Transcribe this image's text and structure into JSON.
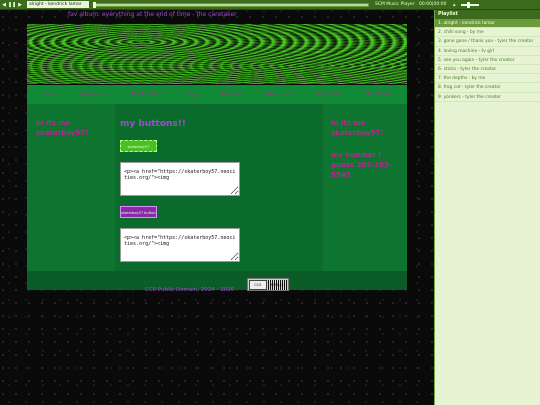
{
  "player": {
    "prev_icon": "prev-icon",
    "play_icon": "play-icon",
    "pause_icon": "pause-icon",
    "next_icon": "next-icon",
    "now_playing": "alright - kendrick lamar",
    "name": "SCM Music Player",
    "time": "00:00|00:00",
    "volume_icon": "volume-icon",
    "volume": 0.4,
    "progress": 0
  },
  "playlist": {
    "title": "Playlist",
    "items": [
      "1. alright - kendrick lamar",
      "2. chilli song - by me",
      "3. gone gone / thank you - tyler the creator",
      "4. loving machine - tv girl",
      "5. see you again - tyler the creator",
      "6. sticks - tyler the creator",
      "7. the depths - by me",
      "8. frog cat - tyler the creator",
      "9. yonkers - tyler the creator"
    ],
    "active_index": 0
  },
  "page": {
    "marquee": "fav album: everything at the end of time - the caretaker",
    "nav": [
      "Home",
      "My Albums",
      "My Art Stuff",
      "Blogs",
      "Reviews",
      "Guestbook",
      "My Shrine",
      "Mt Friends"
    ],
    "left_text": "hi its me skaterboy57!",
    "buttons_title": "my buttons!!",
    "button1_label": "skaterboy57",
    "button2_label": "skaterboy57 button",
    "code1": "<p><a href=\"https://skaterboy57.neocities.org/\"><img",
    "code2": "<p><a href=\"https://skaterboy57.neocities.org/\"><img",
    "right_text1": "hi its me skaterboy57!",
    "right_text2": "my number I guess 208-293-5545",
    "footer": "CC0 Public Domain, 2024 - 2026",
    "badge_icon_text": "CC0",
    "badge_label": "PUBLIC DOMAIN"
  },
  "colors": {
    "accent_purple": "#a04ad0",
    "link_magenta": "#b02a8c",
    "green_dark": "#0b6b2d",
    "green_nav": "#118a38",
    "player_green": "#3d6b1e"
  }
}
